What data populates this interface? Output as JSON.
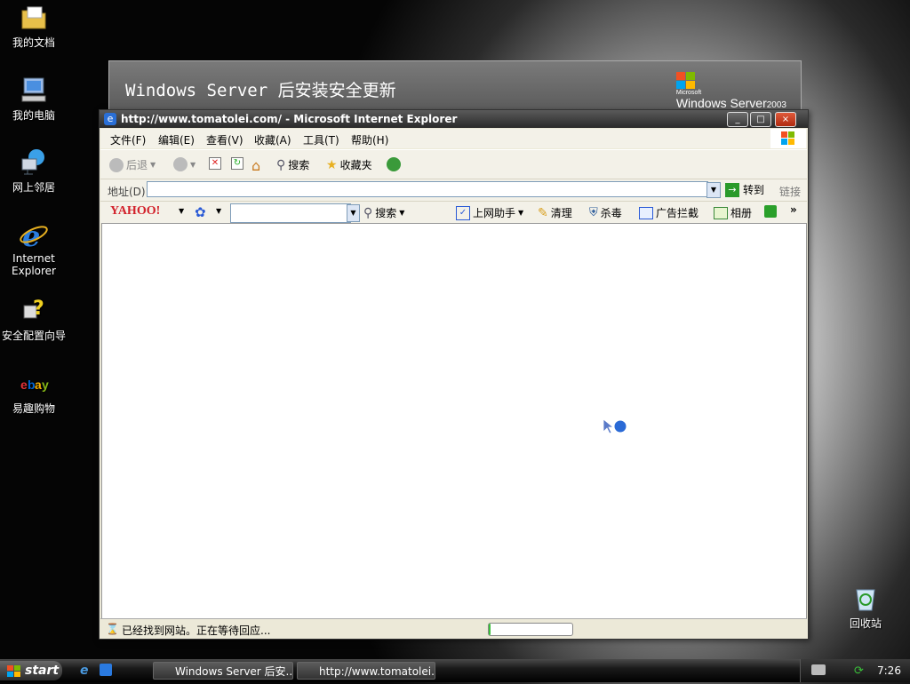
{
  "desktop": {
    "icons": [
      {
        "label": "我的文档"
      },
      {
        "label": "我的电脑"
      },
      {
        "label": "网上邻居"
      },
      {
        "label": "Internet Explorer"
      },
      {
        "label": "安全配置向导"
      },
      {
        "label": "易趣购物"
      },
      {
        "label": "回收站"
      }
    ]
  },
  "bg_window": {
    "title": "Windows Server 后安装安全更新",
    "logo_small": "Microsoft",
    "logo_main": "Windows Server",
    "logo_year": "2003"
  },
  "ie": {
    "title": "http://www.tomatolei.com/ - Microsoft Internet Explorer",
    "controls": {
      "min": "_",
      "max": "□",
      "close": "×"
    },
    "menu": [
      "文件(F)",
      "编辑(E)",
      "查看(V)",
      "收藏(A)",
      "工具(T)",
      "帮助(H)"
    ],
    "toolbar": {
      "back": "后退",
      "search": "搜索",
      "favorites": "收藏夹"
    },
    "address": {
      "label": "地址(D)",
      "value": "",
      "go": "转到",
      "links": "链接"
    },
    "yahoo": {
      "logo": "YAHOO!",
      "search_value": "",
      "search": "搜索",
      "helper": "上网助手",
      "clean": "清理",
      "antivirus": "杀毒",
      "adblock": "广告拦截",
      "album": "相册",
      "more": "»"
    },
    "status": {
      "text": "已经找到网站。正在等待回应...",
      "progress": 0.02
    }
  },
  "taskbar": {
    "start": "start",
    "tasks": [
      "Windows Server 后安...",
      "http://www.tomatolei...."
    ],
    "clock": "7:26"
  }
}
